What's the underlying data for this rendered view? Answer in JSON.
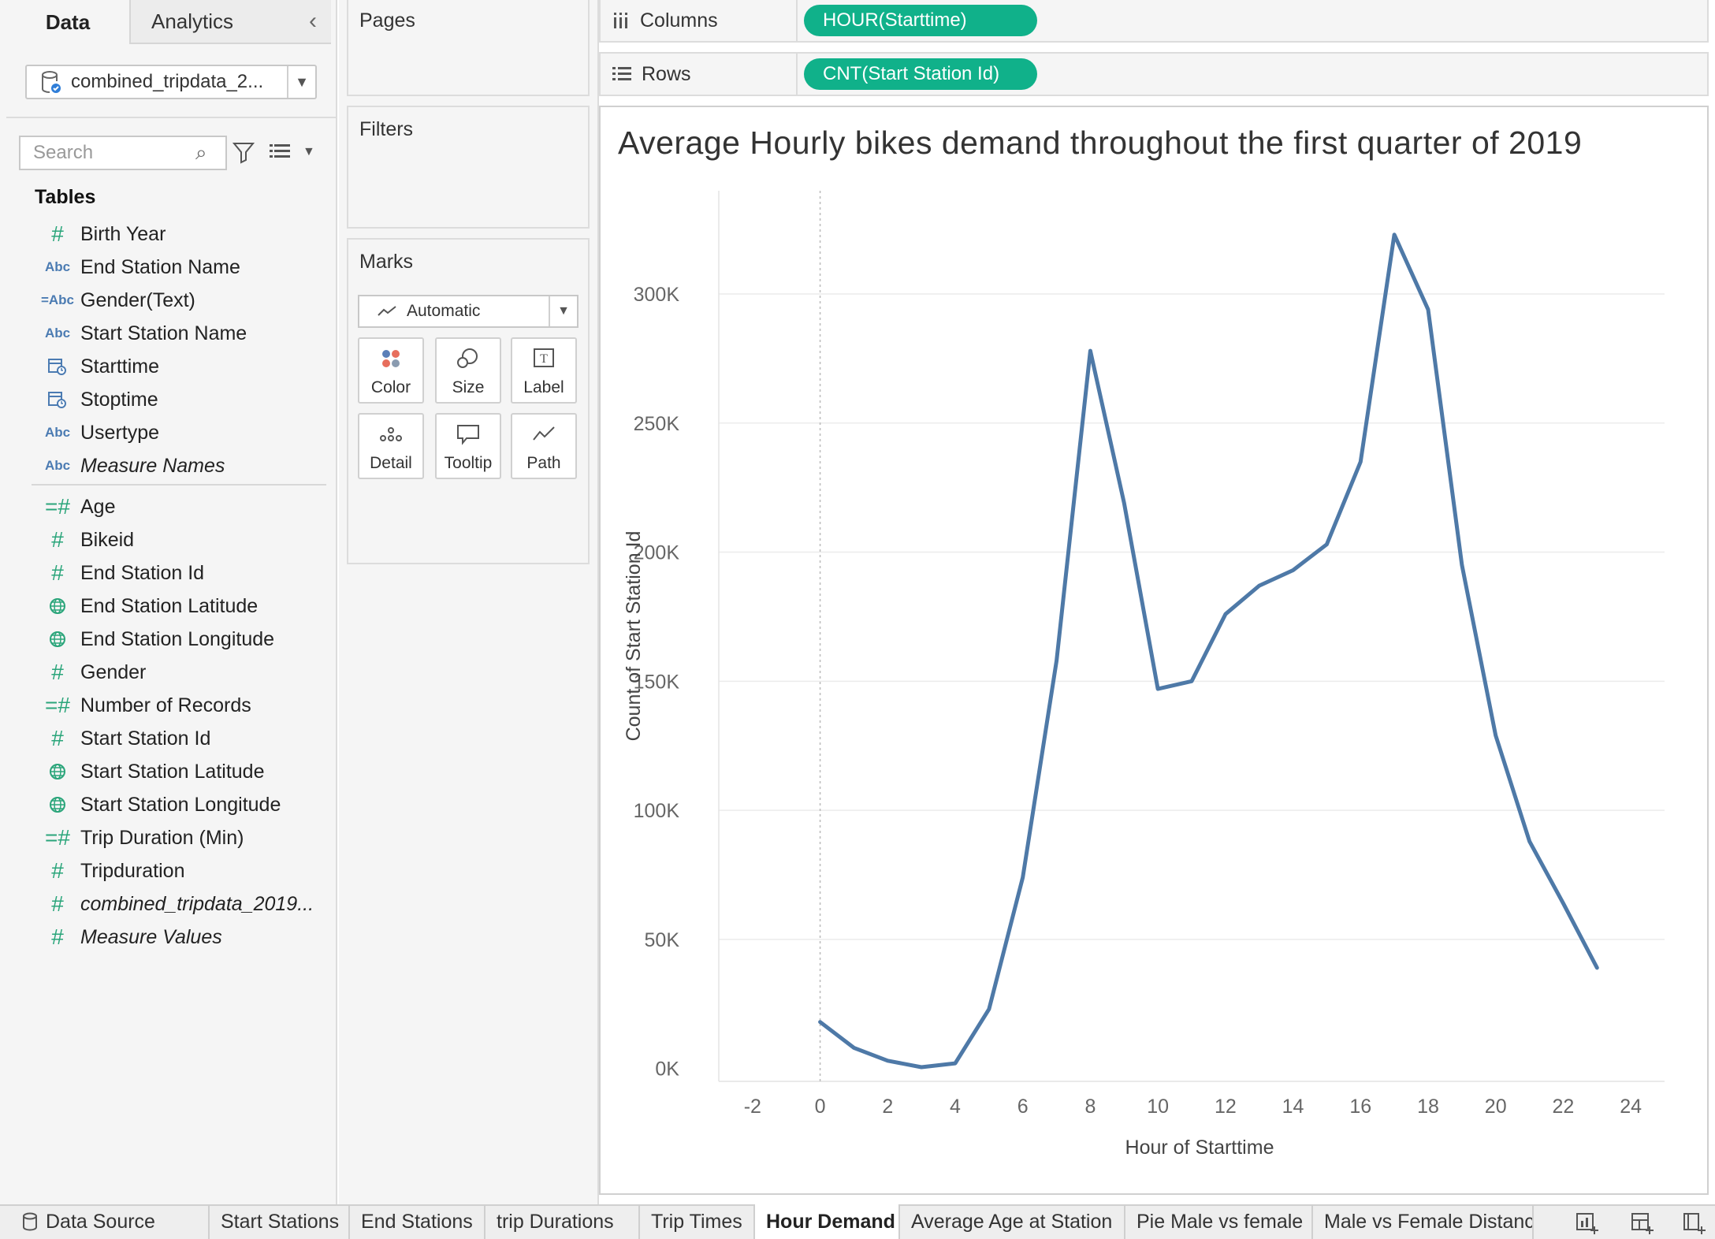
{
  "data_pane": {
    "tabs": [
      "Data",
      "Analytics"
    ],
    "datasource": "combined_tripdata_2...",
    "search_placeholder": "Search",
    "tables_header": "Tables",
    "dimensions": [
      {
        "icon": "number-icon",
        "name": "Birth Year"
      },
      {
        "icon": "abc-icon",
        "name": "End Station Name"
      },
      {
        "icon": "calc-abc-icon",
        "name": "Gender(Text)"
      },
      {
        "icon": "abc-icon",
        "name": "Start Station Name"
      },
      {
        "icon": "calendar-icon",
        "name": "Starttime"
      },
      {
        "icon": "calendar-icon",
        "name": "Stoptime"
      },
      {
        "icon": "abc-icon",
        "name": "Usertype"
      },
      {
        "icon": "abc-icon",
        "name": "Measure Names"
      }
    ],
    "measures": [
      {
        "icon": "calc-number-icon",
        "name": "Age"
      },
      {
        "icon": "number-icon",
        "name": "Bikeid"
      },
      {
        "icon": "number-icon",
        "name": "End Station Id"
      },
      {
        "icon": "globe-icon",
        "name": "End Station Latitude"
      },
      {
        "icon": "globe-icon",
        "name": "End Station Longitude"
      },
      {
        "icon": "number-icon",
        "name": "Gender"
      },
      {
        "icon": "calc-number-icon",
        "name": "Number of Records"
      },
      {
        "icon": "number-icon",
        "name": "Start Station Id"
      },
      {
        "icon": "globe-icon",
        "name": "Start Station Latitude"
      },
      {
        "icon": "globe-icon",
        "name": "Start Station Longitude"
      },
      {
        "icon": "calc-number-icon",
        "name": "Trip Duration (Min)"
      },
      {
        "icon": "number-icon",
        "name": "Tripduration"
      },
      {
        "icon": "number-icon",
        "name": "combined_tripdata_2019..."
      },
      {
        "icon": "number-icon",
        "name": "Measure Values"
      }
    ]
  },
  "cards": {
    "pages": "Pages",
    "filters": "Filters",
    "marks": "Marks",
    "mark_type": "Automatic",
    "mark_buttons": [
      "Color",
      "Size",
      "Label",
      "Detail",
      "Tooltip",
      "Path"
    ]
  },
  "shelves": {
    "columns_label": "Columns",
    "columns_pill": "HOUR(Starttime)",
    "rows_label": "Rows",
    "rows_pill": "CNT(Start Station Id)"
  },
  "bottom_tabs": {
    "data_source": "Data Source",
    "sheets": [
      "Start Stations",
      "End Stations",
      "trip Durations",
      "Trip Times",
      "Hour Demand",
      "Average Age at Station",
      "Pie Male vs female",
      "Male vs Female Distance"
    ],
    "active": "Hour Demand"
  },
  "colors": {
    "line": "#4e79a7",
    "pill": "#10b18a"
  },
  "chart_data": {
    "type": "line",
    "title": "Average Hourly bikes demand throughout the first quarter of 2019",
    "xlabel": "Hour of Starttime",
    "ylabel": "Count of Start Station Id",
    "xlim": [
      -3,
      25
    ],
    "ylim": [
      -5000,
      340000
    ],
    "xticks": [
      -2,
      0,
      2,
      4,
      6,
      8,
      10,
      12,
      14,
      16,
      18,
      20,
      22,
      24
    ],
    "yticks": [
      0,
      50000,
      100000,
      150000,
      200000,
      250000,
      300000
    ],
    "ytick_labels": [
      "0K",
      "50K",
      "100K",
      "150K",
      "200K",
      "250K",
      "300K"
    ],
    "grid": "horizontal",
    "reference_line_x": 0,
    "x": [
      0,
      1,
      2,
      3,
      4,
      5,
      6,
      7,
      8,
      9,
      10,
      11,
      12,
      13,
      14,
      15,
      16,
      17,
      18,
      19,
      20,
      21,
      22,
      23
    ],
    "y": [
      18000,
      8000,
      3000,
      500,
      2000,
      23000,
      74000,
      158000,
      278000,
      219000,
      147000,
      150000,
      176000,
      187000,
      193000,
      203000,
      235000,
      323000,
      294000,
      195000,
      129000,
      88000,
      64000,
      39000
    ]
  }
}
